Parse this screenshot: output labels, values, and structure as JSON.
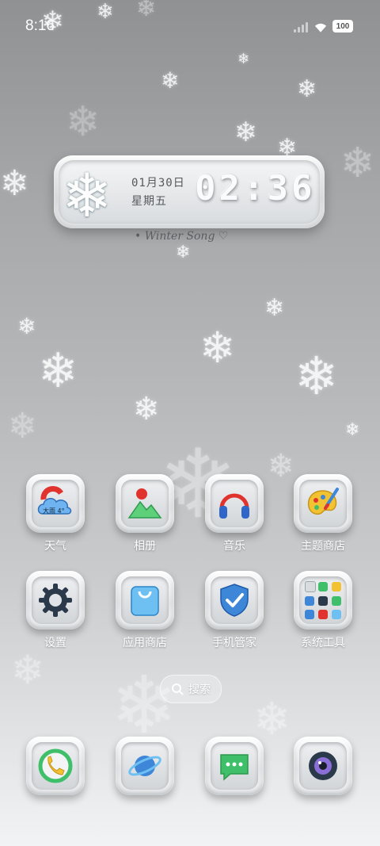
{
  "status_bar": {
    "time": "8:16",
    "battery": "100"
  },
  "clock_widget": {
    "date": "01月30日",
    "weekday": "星期五",
    "time": "02:36",
    "caption": "Winter Song"
  },
  "apps": [
    {
      "label": "天气",
      "weather_text": "大雨 4°"
    },
    {
      "label": "相册"
    },
    {
      "label": "音乐"
    },
    {
      "label": "主题商店"
    },
    {
      "label": "设置"
    },
    {
      "label": "应用商店"
    },
    {
      "label": "手机管家"
    },
    {
      "label": "系统工具"
    }
  ],
  "search": {
    "label": "搜索"
  },
  "dock": {},
  "colors": {
    "accent_red": "#e0332e",
    "accent_blue": "#3d86d8",
    "accent_green": "#3fbf6a",
    "accent_yellow": "#f2c232"
  }
}
